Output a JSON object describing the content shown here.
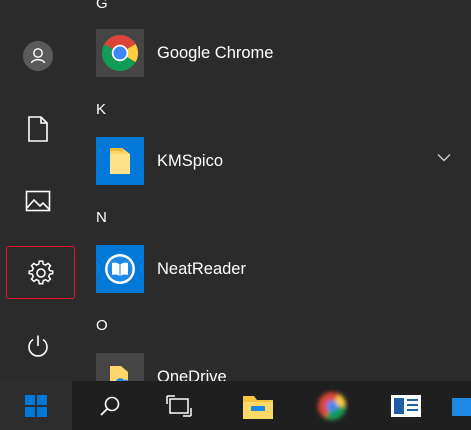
{
  "start_menu": {
    "sections": [
      {
        "letter": "G",
        "apps": [
          {
            "name": "Google Chrome",
            "icon": "chrome-icon"
          }
        ]
      },
      {
        "letter": "K",
        "apps": [
          {
            "name": "KMSpico",
            "icon": "folder-icon",
            "expandable": true
          }
        ]
      },
      {
        "letter": "N",
        "apps": [
          {
            "name": "NeatReader",
            "icon": "neatreader-icon"
          }
        ]
      },
      {
        "letter": "O",
        "apps": [
          {
            "name": "OneDrive",
            "icon": "onedrive-folder-icon"
          }
        ]
      }
    ]
  },
  "rail": {
    "items": [
      {
        "icon": "user-icon"
      },
      {
        "icon": "document-icon"
      },
      {
        "icon": "pictures-icon"
      },
      {
        "icon": "settings-icon",
        "highlighted": true
      },
      {
        "icon": "power-icon"
      }
    ],
    "highlight_color": "#e81123"
  },
  "taskbar": {
    "items": [
      "windows-start-icon",
      "search-icon",
      "task-view-icon",
      "file-explorer-icon",
      "chrome-icon",
      "app-icon",
      "app-icon"
    ],
    "accent": "#0078d7"
  }
}
